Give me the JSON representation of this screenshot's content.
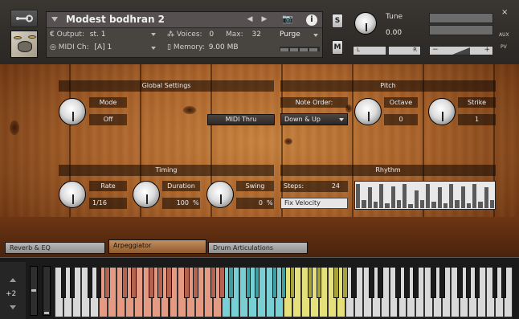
{
  "header": {
    "instrument_name": "Modest bodhran 2",
    "output_label": "Output:",
    "output_value": "st. 1",
    "midi_label": "MIDI Ch:",
    "midi_value": "[A]  1",
    "voices_label": "Voices:",
    "voices_value": "0",
    "max_label": "Max:",
    "max_value": "32",
    "memory_label": "Memory:",
    "memory_value": "9.00 MB",
    "purge_label": "Purge",
    "solo_label": "S",
    "mute_label": "M",
    "tune_label": "Tune",
    "tune_value": "0.00",
    "pan_left": "L",
    "pan_right": "R",
    "vol_minus": "−",
    "vol_plus": "+",
    "aux_label": "AUX",
    "pv_label": "PV",
    "close_label": "×"
  },
  "global_settings": {
    "title": "Global Settings",
    "mode_label": "Mode",
    "mode_value": "Off",
    "midi_thru_label": "MIDI Thru"
  },
  "pitch": {
    "title": "Pitch",
    "note_order_label": "Note Order:",
    "note_order_value": "Down & Up",
    "octave_label": "Octave",
    "octave_value": "0",
    "strike_label": "Strike",
    "strike_value": "1"
  },
  "timing": {
    "title": "Timing",
    "rate_label": "Rate",
    "rate_value": "1/16",
    "duration_label": "Duration",
    "duration_value": "100",
    "duration_unit": "%",
    "swing_label": "Swing",
    "swing_value": "0",
    "swing_unit": "%"
  },
  "rhythm": {
    "title": "Rhythm",
    "steps_label": "Steps:",
    "steps_value": "24",
    "fix_velocity_label": "Fix Velocity",
    "step_levels": [
      0.95,
      0.3,
      0.8,
      0.25,
      0.95,
      0.2,
      0.85,
      0.3,
      0.95,
      0.15,
      0.7,
      0.3,
      0.95,
      0.25,
      0.8,
      0.2,
      0.95,
      0.3,
      0.85,
      0.2,
      0.95,
      0.25,
      0.8,
      0.3
    ]
  },
  "tabs": [
    {
      "label": "Reverb & EQ",
      "active": false
    },
    {
      "label": "Arpeggiator",
      "active": true
    },
    {
      "label": "Drum Articulations",
      "active": false
    }
  ],
  "keyboard": {
    "octave_shift": "+2",
    "colors": {
      "white": "#d9d9d9",
      "salmon": "#e59a84",
      "cyan": "#79d0d4",
      "yellow": "#e6e07a"
    }
  }
}
